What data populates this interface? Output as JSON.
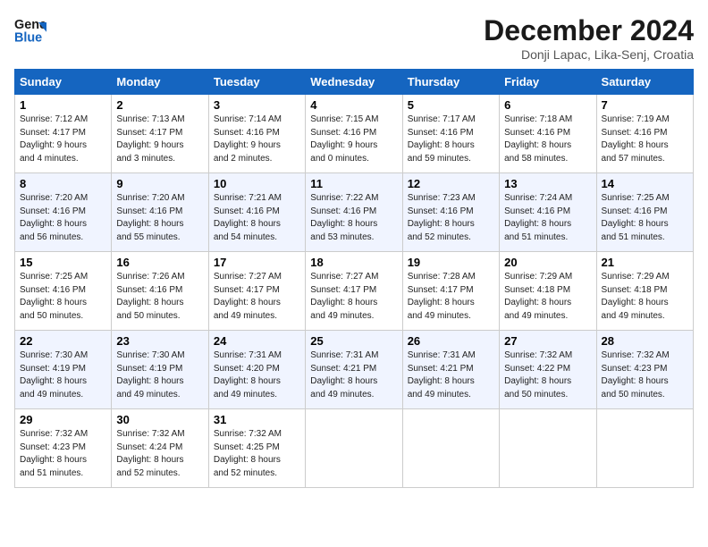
{
  "header": {
    "logo_line1": "General",
    "logo_line2": "Blue",
    "month_title": "December 2024",
    "location": "Donji Lapac, Lika-Senj, Croatia"
  },
  "days_of_week": [
    "Sunday",
    "Monday",
    "Tuesday",
    "Wednesday",
    "Thursday",
    "Friday",
    "Saturday"
  ],
  "weeks": [
    [
      {
        "day": 1,
        "lines": [
          "Sunrise: 7:12 AM",
          "Sunset: 4:17 PM",
          "Daylight: 9 hours",
          "and 4 minutes."
        ]
      },
      {
        "day": 2,
        "lines": [
          "Sunrise: 7:13 AM",
          "Sunset: 4:17 PM",
          "Daylight: 9 hours",
          "and 3 minutes."
        ]
      },
      {
        "day": 3,
        "lines": [
          "Sunrise: 7:14 AM",
          "Sunset: 4:16 PM",
          "Daylight: 9 hours",
          "and 2 minutes."
        ]
      },
      {
        "day": 4,
        "lines": [
          "Sunrise: 7:15 AM",
          "Sunset: 4:16 PM",
          "Daylight: 9 hours",
          "and 0 minutes."
        ]
      },
      {
        "day": 5,
        "lines": [
          "Sunrise: 7:17 AM",
          "Sunset: 4:16 PM",
          "Daylight: 8 hours",
          "and 59 minutes."
        ]
      },
      {
        "day": 6,
        "lines": [
          "Sunrise: 7:18 AM",
          "Sunset: 4:16 PM",
          "Daylight: 8 hours",
          "and 58 minutes."
        ]
      },
      {
        "day": 7,
        "lines": [
          "Sunrise: 7:19 AM",
          "Sunset: 4:16 PM",
          "Daylight: 8 hours",
          "and 57 minutes."
        ]
      }
    ],
    [
      {
        "day": 8,
        "lines": [
          "Sunrise: 7:20 AM",
          "Sunset: 4:16 PM",
          "Daylight: 8 hours",
          "and 56 minutes."
        ]
      },
      {
        "day": 9,
        "lines": [
          "Sunrise: 7:20 AM",
          "Sunset: 4:16 PM",
          "Daylight: 8 hours",
          "and 55 minutes."
        ]
      },
      {
        "day": 10,
        "lines": [
          "Sunrise: 7:21 AM",
          "Sunset: 4:16 PM",
          "Daylight: 8 hours",
          "and 54 minutes."
        ]
      },
      {
        "day": 11,
        "lines": [
          "Sunrise: 7:22 AM",
          "Sunset: 4:16 PM",
          "Daylight: 8 hours",
          "and 53 minutes."
        ]
      },
      {
        "day": 12,
        "lines": [
          "Sunrise: 7:23 AM",
          "Sunset: 4:16 PM",
          "Daylight: 8 hours",
          "and 52 minutes."
        ]
      },
      {
        "day": 13,
        "lines": [
          "Sunrise: 7:24 AM",
          "Sunset: 4:16 PM",
          "Daylight: 8 hours",
          "and 51 minutes."
        ]
      },
      {
        "day": 14,
        "lines": [
          "Sunrise: 7:25 AM",
          "Sunset: 4:16 PM",
          "Daylight: 8 hours",
          "and 51 minutes."
        ]
      }
    ],
    [
      {
        "day": 15,
        "lines": [
          "Sunrise: 7:25 AM",
          "Sunset: 4:16 PM",
          "Daylight: 8 hours",
          "and 50 minutes."
        ]
      },
      {
        "day": 16,
        "lines": [
          "Sunrise: 7:26 AM",
          "Sunset: 4:16 PM",
          "Daylight: 8 hours",
          "and 50 minutes."
        ]
      },
      {
        "day": 17,
        "lines": [
          "Sunrise: 7:27 AM",
          "Sunset: 4:17 PM",
          "Daylight: 8 hours",
          "and 49 minutes."
        ]
      },
      {
        "day": 18,
        "lines": [
          "Sunrise: 7:27 AM",
          "Sunset: 4:17 PM",
          "Daylight: 8 hours",
          "and 49 minutes."
        ]
      },
      {
        "day": 19,
        "lines": [
          "Sunrise: 7:28 AM",
          "Sunset: 4:17 PM",
          "Daylight: 8 hours",
          "and 49 minutes."
        ]
      },
      {
        "day": 20,
        "lines": [
          "Sunrise: 7:29 AM",
          "Sunset: 4:18 PM",
          "Daylight: 8 hours",
          "and 49 minutes."
        ]
      },
      {
        "day": 21,
        "lines": [
          "Sunrise: 7:29 AM",
          "Sunset: 4:18 PM",
          "Daylight: 8 hours",
          "and 49 minutes."
        ]
      }
    ],
    [
      {
        "day": 22,
        "lines": [
          "Sunrise: 7:30 AM",
          "Sunset: 4:19 PM",
          "Daylight: 8 hours",
          "and 49 minutes."
        ]
      },
      {
        "day": 23,
        "lines": [
          "Sunrise: 7:30 AM",
          "Sunset: 4:19 PM",
          "Daylight: 8 hours",
          "and 49 minutes."
        ]
      },
      {
        "day": 24,
        "lines": [
          "Sunrise: 7:31 AM",
          "Sunset: 4:20 PM",
          "Daylight: 8 hours",
          "and 49 minutes."
        ]
      },
      {
        "day": 25,
        "lines": [
          "Sunrise: 7:31 AM",
          "Sunset: 4:21 PM",
          "Daylight: 8 hours",
          "and 49 minutes."
        ]
      },
      {
        "day": 26,
        "lines": [
          "Sunrise: 7:31 AM",
          "Sunset: 4:21 PM",
          "Daylight: 8 hours",
          "and 49 minutes."
        ]
      },
      {
        "day": 27,
        "lines": [
          "Sunrise: 7:32 AM",
          "Sunset: 4:22 PM",
          "Daylight: 8 hours",
          "and 50 minutes."
        ]
      },
      {
        "day": 28,
        "lines": [
          "Sunrise: 7:32 AM",
          "Sunset: 4:23 PM",
          "Daylight: 8 hours",
          "and 50 minutes."
        ]
      }
    ],
    [
      {
        "day": 29,
        "lines": [
          "Sunrise: 7:32 AM",
          "Sunset: 4:23 PM",
          "Daylight: 8 hours",
          "and 51 minutes."
        ]
      },
      {
        "day": 30,
        "lines": [
          "Sunrise: 7:32 AM",
          "Sunset: 4:24 PM",
          "Daylight: 8 hours",
          "and 52 minutes."
        ]
      },
      {
        "day": 31,
        "lines": [
          "Sunrise: 7:32 AM",
          "Sunset: 4:25 PM",
          "Daylight: 8 hours",
          "and 52 minutes."
        ]
      },
      null,
      null,
      null,
      null
    ]
  ]
}
